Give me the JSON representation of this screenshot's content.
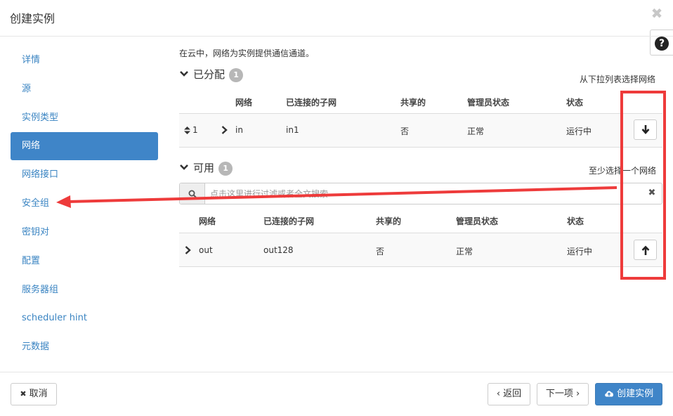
{
  "modal": {
    "title": "创建实例",
    "close_symbol": "✖",
    "help_symbol": "?"
  },
  "sidebar": {
    "items": [
      {
        "label": "详情",
        "active": false
      },
      {
        "label": "源",
        "active": false
      },
      {
        "label": "实例类型",
        "active": false
      },
      {
        "label": "网络",
        "active": true
      },
      {
        "label": "网络接口",
        "active": false
      },
      {
        "label": "安全组",
        "active": false
      },
      {
        "label": "密钥对",
        "active": false
      },
      {
        "label": "配置",
        "active": false
      },
      {
        "label": "服务器组",
        "active": false
      },
      {
        "label": "scheduler hint",
        "active": false
      },
      {
        "label": "元数据",
        "active": false
      }
    ]
  },
  "content": {
    "help_text": "在云中，网络为实例提供通信通道。",
    "allocated": {
      "title": "已分配",
      "count": "1",
      "hint": "从下拉列表选择网络",
      "columns": [
        "网络",
        "已连接的子网",
        "共享的",
        "管理员状态",
        "状态"
      ],
      "rows": [
        {
          "order": "1",
          "network": "in",
          "subnet": "in1",
          "shared": "否",
          "admin_state": "正常",
          "status": "运行中"
        }
      ]
    },
    "available": {
      "title": "可用",
      "count": "1",
      "hint": "至少选择一个网络",
      "search_placeholder": "点击这里进行过滤或者全文搜索",
      "columns": [
        "网络",
        "已连接的子网",
        "共享的",
        "管理员状态",
        "状态"
      ],
      "rows": [
        {
          "network": "out",
          "subnet": "out128",
          "shared": "否",
          "admin_state": "正常",
          "status": "运行中"
        }
      ]
    }
  },
  "footer": {
    "cancel_label": "取消",
    "back_label": "‹ 返回",
    "next_label": "下一项 ›",
    "create_label": "创建实例"
  },
  "icons": {
    "close": "close-icon",
    "help": "question-circle-icon",
    "section_toggle": "chevron-down-icon",
    "sort": "sort-icon",
    "expand": "chevron-right-icon",
    "move_down": "arrow-down-icon",
    "move_up": "arrow-up-icon",
    "search": "search-icon",
    "cloud_upload": "cloud-upload-icon"
  },
  "colors": {
    "primary": "#3f85c8",
    "link": "#3a84c2",
    "annotation": "#ee3b3b",
    "badge": "#b7b7b7"
  }
}
